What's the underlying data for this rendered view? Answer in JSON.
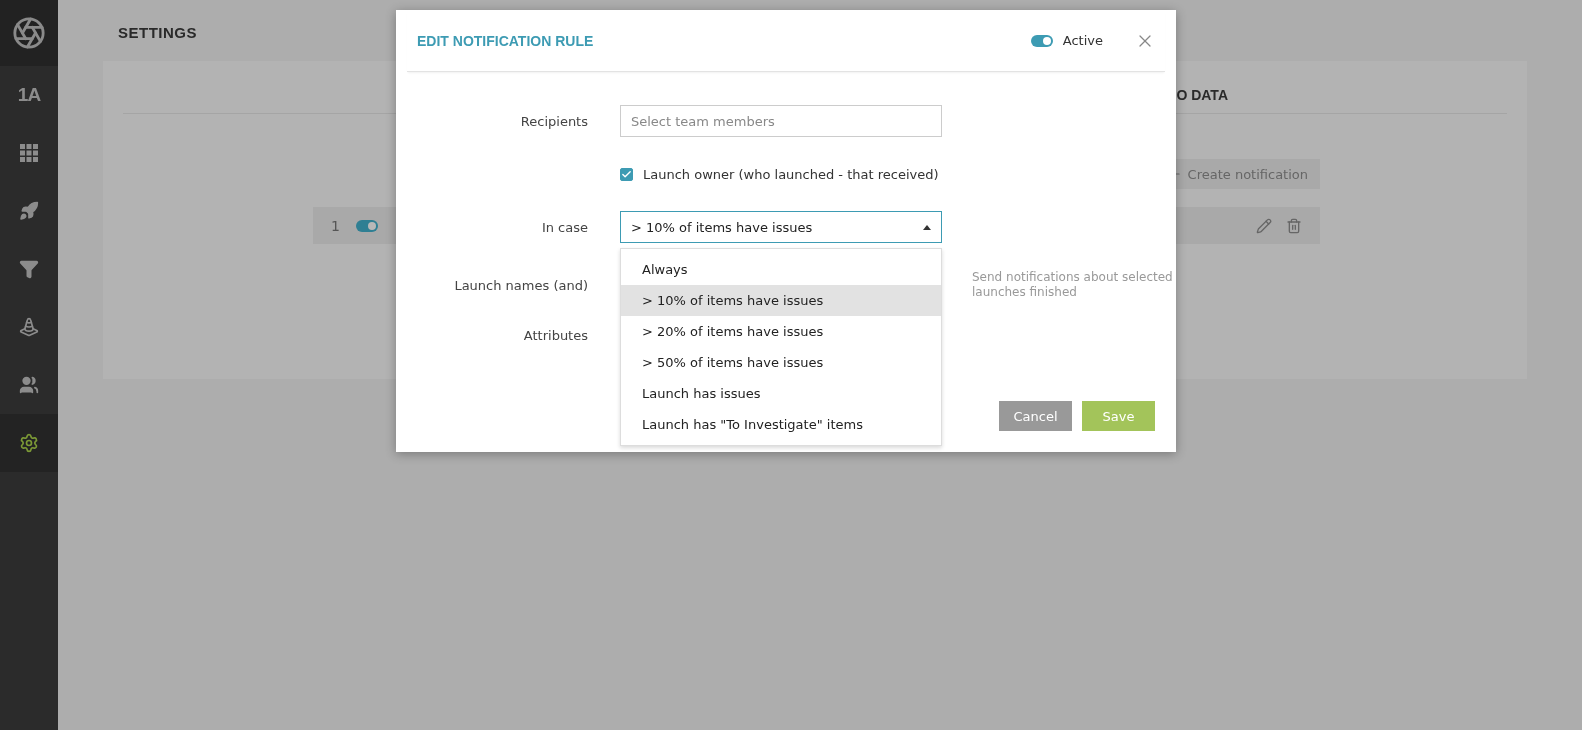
{
  "sidebar": {
    "items": [
      {
        "kind": "text",
        "label": "1A",
        "selected": false
      },
      {
        "kind": "grid",
        "selected": false
      },
      {
        "kind": "rocket",
        "selected": false
      },
      {
        "kind": "filter",
        "selected": false
      },
      {
        "kind": "cone",
        "selected": false
      },
      {
        "kind": "users",
        "selected": false
      },
      {
        "kind": "gear",
        "selected": true
      }
    ]
  },
  "page": {
    "title": "SETTINGS",
    "card_header": "O DATA",
    "create_button": "Create notification",
    "rules": [
      {
        "number": "1",
        "on": true
      }
    ]
  },
  "modal": {
    "title": "EDIT NOTIFICATION RULE",
    "active": {
      "label": "Active",
      "on": true
    },
    "fields": [
      {
        "kind": "input",
        "label": "Recipients",
        "placeholder": "Select team members"
      },
      {
        "kind": "checkbox",
        "label": "Launch owner (who launched - that received)",
        "checked": true
      },
      {
        "kind": "select",
        "label": "In case",
        "value": "> 10% of items have issues",
        "expanded": true
      },
      {
        "kind": "hint",
        "label": "Launch names (and)",
        "hint": "Send notifications about selected launches finished"
      },
      {
        "kind": "plain",
        "label": "Attributes"
      }
    ],
    "options": [
      {
        "label": "Always",
        "selected": false
      },
      {
        "label": "> 10% of items have issues",
        "selected": true
      },
      {
        "label": "> 20% of items have issues",
        "selected": false
      },
      {
        "label": "> 50% of items have issues",
        "selected": false
      },
      {
        "label": "Launch has issues",
        "selected": false
      },
      {
        "label": "Launch has \"To Investigate\" items",
        "selected": false
      }
    ],
    "buttons": [
      {
        "kind": "secondary",
        "label": "Cancel"
      },
      {
        "kind": "primary",
        "label": "Save"
      }
    ]
  }
}
